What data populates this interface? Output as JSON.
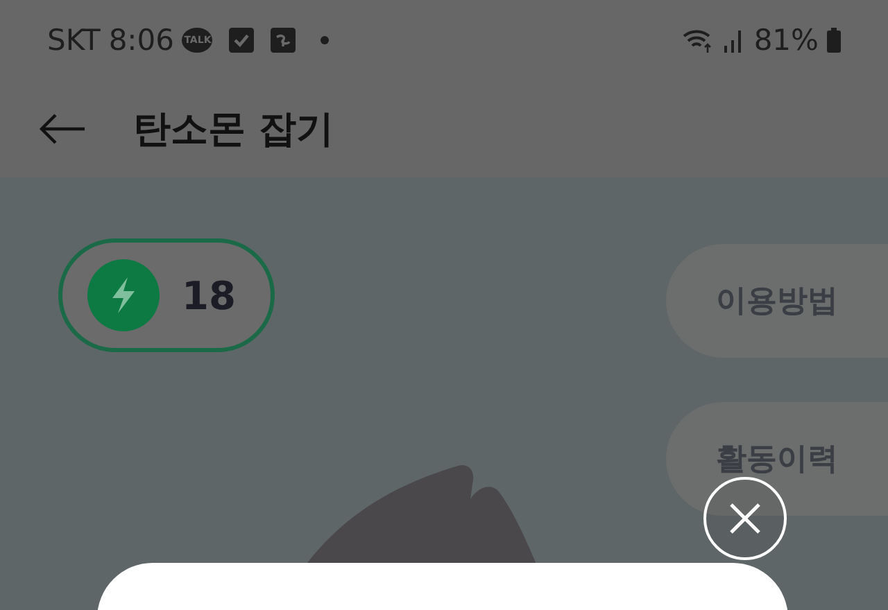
{
  "status_bar": {
    "carrier": "SKT",
    "time": "8:06",
    "chat_badge": "TALK",
    "battery": "81%"
  },
  "header": {
    "title": "탄소몬 잡기"
  },
  "energy": {
    "count": "18"
  },
  "side_buttons": [
    "이용방법",
    "활동이력"
  ]
}
